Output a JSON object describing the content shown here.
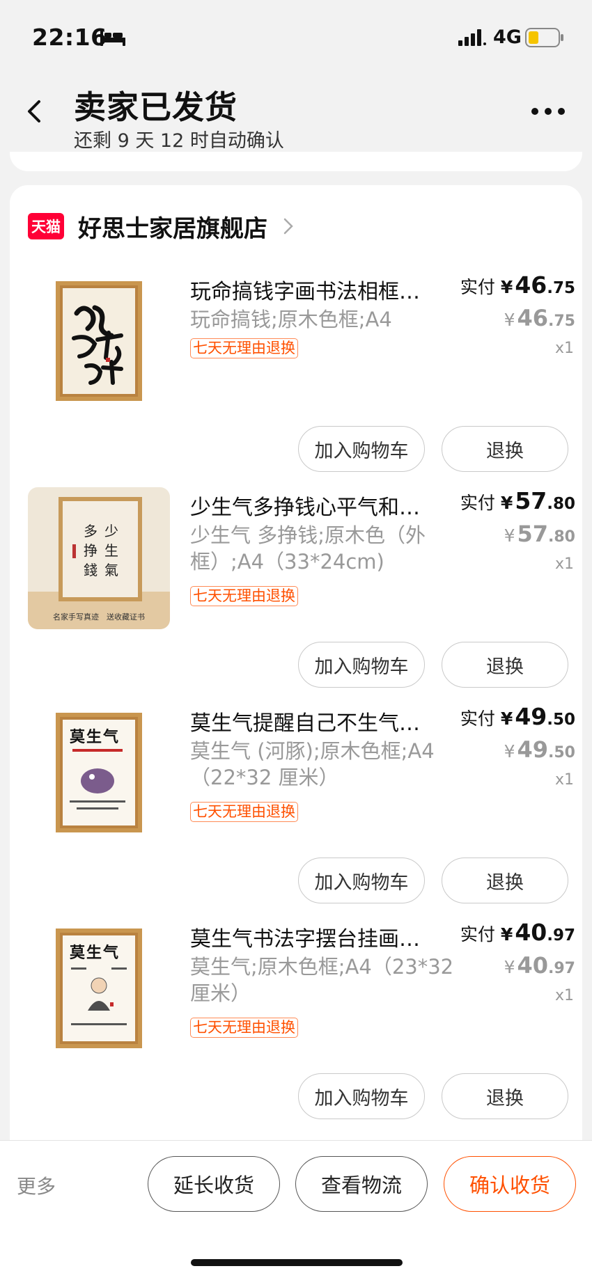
{
  "status_bar": {
    "time": "22:16",
    "network": "4G",
    "icons": [
      "bed-icon",
      "signal-icon",
      "battery-icon"
    ],
    "battery_color": "#f5c400"
  },
  "header": {
    "title": "卖家已发货",
    "subtitle": "还剩 9 天 12 时自动确认",
    "icons": [
      "back-icon",
      "more-icon"
    ]
  },
  "store": {
    "badge": "天猫",
    "name": "好思士家居旗舰店",
    "badge_color": "#ff0036"
  },
  "items": [
    {
      "title": "玩命搞钱字画书法相框…",
      "spec": "玩命搞钱;原木色框;A4",
      "tag": "七天无理由退换",
      "paid_label": "实付",
      "currency": "¥",
      "paid_int": "46",
      "paid_dec": ".75",
      "orig_int": "46",
      "orig_dec": ".75",
      "qty": "x1",
      "cart_label": "加入购物车",
      "return_label": "退换"
    },
    {
      "title": "少生气多挣钱心平气和…",
      "spec": "少生气 多挣钱;原木色（外框）;A4（33*24cm)",
      "tag": "七天无理由退换",
      "paid_label": "实付",
      "currency": "¥",
      "paid_int": "57",
      "paid_dec": ".80",
      "orig_int": "57",
      "orig_dec": ".80",
      "qty": "x1",
      "cart_label": "加入购物车",
      "return_label": "退换",
      "thumb_caption": "名家手写真迹　送收藏证书"
    },
    {
      "title": "莫生气提醒自己不生气…",
      "spec": "莫生气 (河豚);原木色框;A4（22*32 厘米）",
      "tag": "七天无理由退换",
      "paid_label": "实付",
      "currency": "¥",
      "paid_int": "49",
      "paid_dec": ".50",
      "orig_int": "49",
      "orig_dec": ".50",
      "qty": "x1",
      "cart_label": "加入购物车",
      "return_label": "退换"
    },
    {
      "title": "莫生气书法字摆台挂画…",
      "spec": "莫生气;原木色框;A4（23*32 厘米）",
      "tag": "七天无理由退换",
      "paid_label": "实付",
      "currency": "¥",
      "paid_int": "40",
      "paid_dec": ".97",
      "orig_int": "40",
      "orig_dec": ".97",
      "qty": "x1",
      "cart_label": "加入购物车",
      "return_label": "退换"
    }
  ],
  "bottom_bar": {
    "more": "更多",
    "extend": "延长收货",
    "logistics": "查看物流",
    "confirm": "确认收货",
    "accent_color": "#ff5000"
  }
}
